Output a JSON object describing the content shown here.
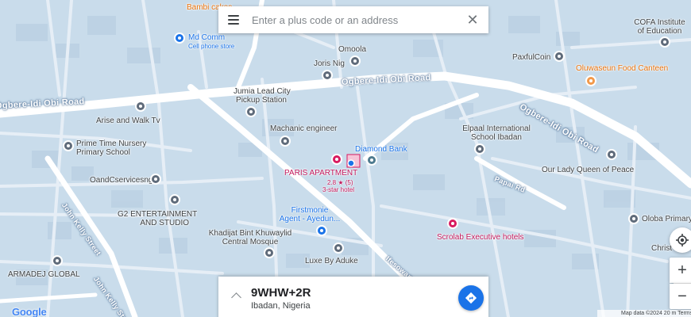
{
  "search": {
    "placeholder": "Enter a plus code or an address"
  },
  "info_card": {
    "plus_code": "9WHW+2R",
    "locality": "Ibadan, Nigeria"
  },
  "roads": {
    "ogbere_idi_obi_left": "Ogbere-Idi Obi Road",
    "ogbere_idi_obi_center": "Ogbere-Idi Obi Road",
    "ogbere_idi_obi_right": "Ogbere-Idi Obi Road",
    "papai_rd": "Papai Rd",
    "john_kelly_upper": "John Kelly Street",
    "john_kelly_lower": "John Kelly Street",
    "ifesowapo": "Ifesowapo"
  },
  "places": {
    "bambi": "Bambi cakes",
    "md_comm": "Md Comm",
    "md_comm_sub": "Cell phone store",
    "omoola": "Omoola",
    "joris_nig": "Joris Nig",
    "jumia": "Jumia Lead City\nPickup Station",
    "machanic": "Machanic engineer",
    "arise": "Arise and Walk Tv",
    "prime_time": "Prime Time Nursery\nPrimary School",
    "oandc": "OandCservicesng",
    "g2": "G2 ENTERTAINMENT\nAND STUDIO",
    "paris": "PARIS APARTMENT",
    "paris_rating": "2.8 ★ (5)",
    "paris_class": "3-star hotel",
    "diamond": "Diamond Bank",
    "firstmonie": "Firstmonie\nAgent - Ayedun...",
    "khadijat": "Khadijat Bint Khuwaylid\nCentral Mosque",
    "luxe": "Luxe By Aduke",
    "armadej": "ARMADEJ GLOBAL",
    "cofa": "COFA Institute\nof Education",
    "paxful": "PaxfulCoin",
    "oluwaseun": "Oluwaseun Food Canteen",
    "elpaal": "Elpaal International\nSchool Ibadan",
    "our_lady": "Our Lady Queen of Peace",
    "scrolab": "Scrolab Executive hotels",
    "oloba": "Oloba Primary",
    "christ": "Christ"
  },
  "attribution": {
    "logo": "Google",
    "map_data": "Map data ©2024   20 m   Terms"
  },
  "icons": {
    "menu": "hamburger-menu-icon",
    "close": "close-icon",
    "directions": "directions-icon",
    "my_location": "my-location-icon"
  },
  "colors": {
    "map_bg": "#c9dceb",
    "road": "#ffffff",
    "accent": "#1a73e8",
    "hotel_pin": "#d81b60",
    "food_pin": "#f2994a"
  }
}
